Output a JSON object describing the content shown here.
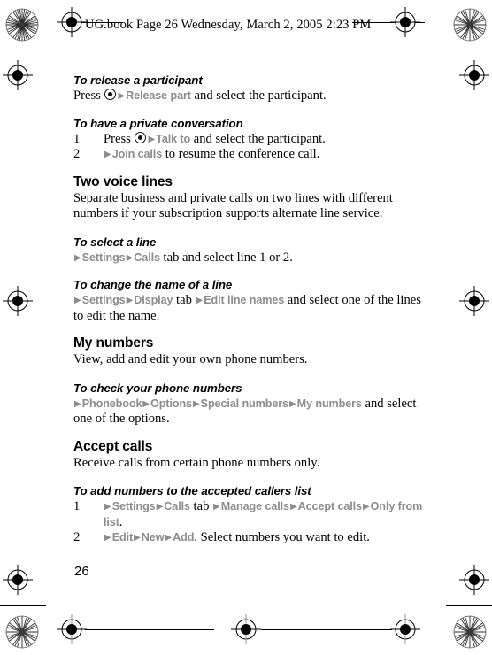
{
  "page": {
    "header_text": "UG.book  Page 26  Wednesday, March 2, 2005  2:23 PM",
    "page_number": "26",
    "menu_color": "#8c8c8c",
    "text_color": "#000000",
    "background": "#ffffff"
  },
  "icons": {
    "joystick_select": "joystick-select-icon",
    "menu_arrow": "▶",
    "registration": "registration-crosshair-icon",
    "starburst": "starburst-test-pattern-icon"
  },
  "sections": [
    {
      "id": "release-participant",
      "type": "task",
      "heading": "To release a participant",
      "body": {
        "prefix": "Press ",
        "has_joystick": true,
        "arrow1": "▶",
        "menu1": "Release part",
        "suffix": " and select the participant."
      }
    },
    {
      "id": "private-conversation",
      "type": "task",
      "heading": "To have a private conversation",
      "items": [
        {
          "num": "1",
          "prefix": "Press ",
          "has_joystick": true,
          "arrow1": "▶",
          "menu1": "Talk to",
          "suffix": " and select the participant."
        },
        {
          "num": "2",
          "prefix": "",
          "has_joystick": false,
          "arrow1": "▶",
          "menu1": "Join calls",
          "suffix": " to resume the conference call."
        }
      ]
    },
    {
      "id": "two-voice-lines",
      "type": "section",
      "heading": "Two voice lines",
      "paragraph": "Separate business and private calls on two lines with different numbers if your subscription supports alternate line service."
    },
    {
      "id": "select-a-line",
      "type": "task",
      "heading": "To select a line",
      "path": {
        "arrow1": "▶",
        "menu1": "Settings",
        "arrow2": "▶",
        "menu2": "Calls",
        "tail": " tab and select line 1 or 2."
      }
    },
    {
      "id": "change-line-name",
      "type": "task",
      "heading": "To change the name of a line",
      "path": {
        "arrow1": "▶",
        "menu1": "Settings",
        "arrow2": "▶",
        "menu2": "Display",
        "mid": " tab ",
        "arrow3": "▶",
        "menu3": "Edit line names",
        "tail": " and select one of the lines to edit the name."
      }
    },
    {
      "id": "my-numbers",
      "type": "section",
      "heading": "My numbers",
      "paragraph": "View, add and edit your own phone numbers."
    },
    {
      "id": "check-phone-numbers",
      "type": "task",
      "heading": "To check your phone numbers",
      "path": {
        "arrow1": "▶",
        "menu1": "Phonebook",
        "arrow2": "▶",
        "menu2": "Options",
        "arrow3": "▶",
        "menu3": "Special numbers",
        "arrow4": "▶",
        "menu4": "My numbers",
        "tail": " and select one of the options."
      }
    },
    {
      "id": "accept-calls",
      "type": "section",
      "heading": "Accept calls",
      "paragraph": "Receive calls from certain phone numbers only."
    },
    {
      "id": "add-accepted-callers",
      "type": "task",
      "heading": "To add numbers to the accepted callers list",
      "items": [
        {
          "num": "1",
          "arrow1": "▶",
          "menu1": "Settings",
          "arrow2": "▶",
          "menu2": "Calls",
          "mid": " tab ",
          "arrow3": "▶",
          "menu3": "Manage calls",
          "arrow4": "▶",
          "menu4": "Accept calls",
          "arrow5": "▶",
          "menu5": "Only from list",
          "tail": "."
        },
        {
          "num": "2",
          "arrow1": "▶",
          "menu1": "Edit",
          "arrow2": "▶",
          "menu2": "New",
          "arrow3": "▶",
          "menu3": "Add",
          "tail": ". Select numbers you want to edit."
        }
      ]
    }
  ]
}
